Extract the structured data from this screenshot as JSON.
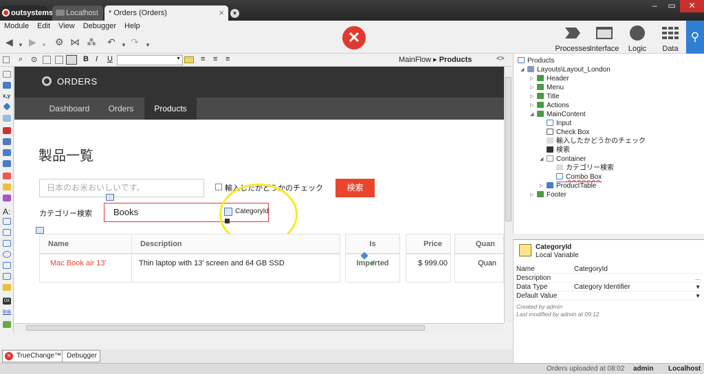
{
  "tabs": [
    {
      "label": "outsystems"
    },
    {
      "label": "Localhost"
    },
    {
      "label": "* Orders (Orders)"
    }
  ],
  "window_controls": {
    "minimize": "–",
    "restore": "▭",
    "close": "✕"
  },
  "menu": [
    "Module",
    "Edit",
    "View",
    "Debugger",
    "Help"
  ],
  "ribbon": [
    {
      "label": "Processes",
      "icon": "processes-icon"
    },
    {
      "label": "Interface",
      "icon": "interface-icon"
    },
    {
      "label": "Logic",
      "icon": "logic-icon"
    },
    {
      "label": "Data",
      "icon": "data-icon"
    }
  ],
  "breadcrumb": {
    "flow": "MainFlow",
    "separator": "▸",
    "screen": "Products"
  },
  "canvas": {
    "app_title": "ORDERS",
    "nav": [
      "Dashboard",
      "Orders",
      "Products"
    ],
    "page_title": "製品一覧",
    "search_placeholder": "日本のお米おいしいです。",
    "checkbox_label": "輸入したかどうかのチェック",
    "search_button": "検索",
    "category_label": "カテゴリー検索",
    "combo_value": "Books",
    "combo_variable": "CategoryId",
    "table": {
      "headers": [
        "Name",
        "Description",
        "Is Imported",
        "Price",
        "Quan"
      ],
      "row": {
        "name": "Mac Book air 13'",
        "description": "Thin laptop with 13' screen and 64 GB SSD",
        "imported": "✔",
        "price": "$ 999.00",
        "quantity": "Quan"
      }
    }
  },
  "bottom_tabs": [
    "TrueChange™",
    "Debugger"
  ],
  "status": {
    "upload": "Orders uploaded at 08:02",
    "user": "admin",
    "server": "Localhost"
  },
  "tree": {
    "root": "Products",
    "layout": "Layouts\\Layout_London",
    "header": "Header",
    "menu": "Menu",
    "title": "Title",
    "actions": "Actions",
    "main_content": "MainContent",
    "input": "Input",
    "check_box": "Check Box",
    "expr_label": "輸入したかどうかのチェック",
    "button": "検索",
    "container": "Container",
    "cat_label": "カテゴリー検索",
    "combo_box": "Combo Box",
    "product_table": "ProductTable",
    "footer": "Footer"
  },
  "properties": {
    "name": "CategoryId",
    "kind": "Local Variable",
    "rows": [
      {
        "key": "Name",
        "value": "CategoryId"
      },
      {
        "key": "Description",
        "value": ""
      },
      {
        "key": "Data Type",
        "value": "Category Identifier"
      },
      {
        "key": "Default Value",
        "value": ""
      }
    ],
    "created": "Created by admin",
    "modified": "Last modified by admin at 09:12"
  },
  "colors": {
    "accent": "#e8452c",
    "header": "#333333",
    "nav": "#4a4a4a",
    "highlight": "#f6ec1e",
    "search": "#2e7fd4"
  }
}
